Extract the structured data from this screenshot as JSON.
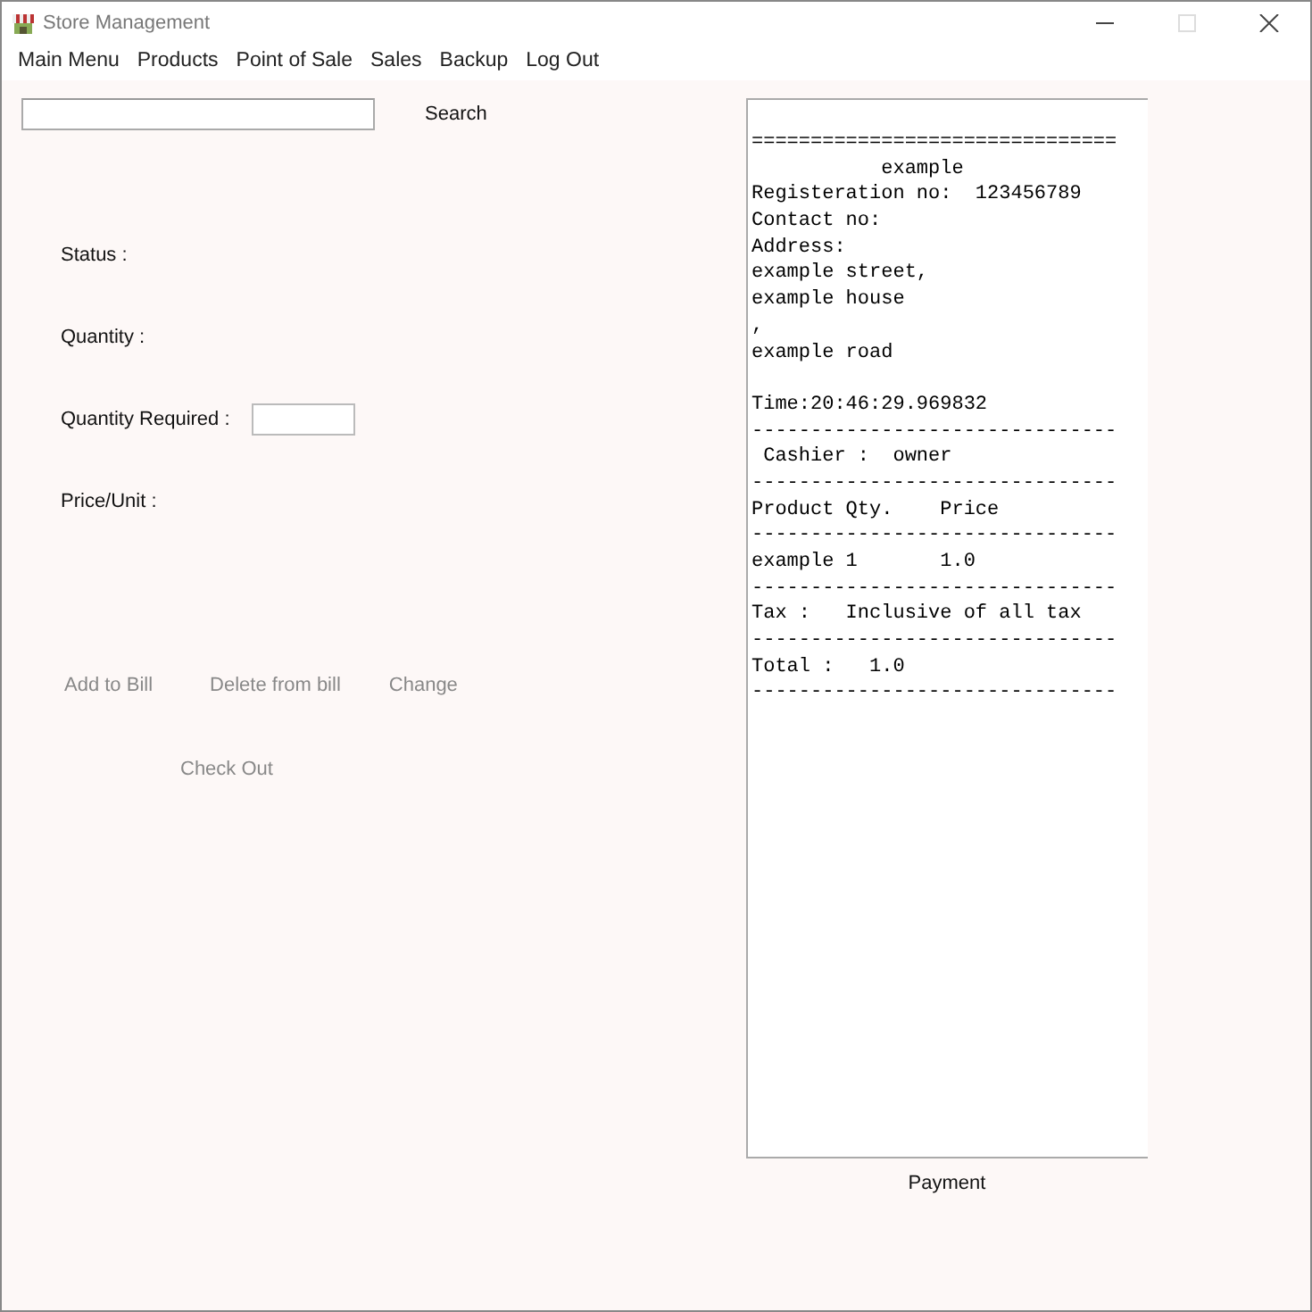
{
  "window": {
    "title": "Store Management",
    "controls": [
      {
        "kind": "minimize",
        "disabled": false
      },
      {
        "kind": "maximize",
        "disabled": true
      },
      {
        "kind": "close",
        "disabled": false
      }
    ]
  },
  "menu": [
    "Main Menu",
    "Products",
    "Point of Sale",
    "Sales",
    "Backup",
    "Log Out"
  ],
  "search": {
    "button": {
      "label": "Search",
      "disabled": false
    }
  },
  "fields": [
    {
      "label": "Status :",
      "kind": "text"
    },
    {
      "label": "Quantity :",
      "kind": "text"
    },
    {
      "label": "Quantity Required :",
      "kind": "input"
    },
    {
      "label": "Price/Unit :",
      "kind": "text"
    }
  ],
  "actions": [
    {
      "label": "Add to Bill",
      "disabled": true
    },
    {
      "label": "Delete from bill",
      "disabled": true
    },
    {
      "label": "Change",
      "disabled": true
    }
  ],
  "checkout": {
    "label": "Check Out",
    "disabled": true
  },
  "receipt": {
    "blocks": [
      [
        "===============================",
        "           example",
        "Registeration no:  123456789",
        "Contact no:",
        "Address:",
        "example street,",
        "example house",
        ",",
        "example road"
      ],
      [
        "Time:20:46:29.969832",
        "-------------------------------",
        " Cashier :  owner",
        "-------------------------------",
        "Product Qty.    Price",
        "-------------------------------",
        "example 1       1.0",
        "-------------------------------",
        "Tax :   Inclusive of all tax",
        "-------------------------------",
        "Total :   1.0",
        "-------------------------------"
      ]
    ]
  },
  "payment": {
    "label": "Payment",
    "disabled": false
  }
}
